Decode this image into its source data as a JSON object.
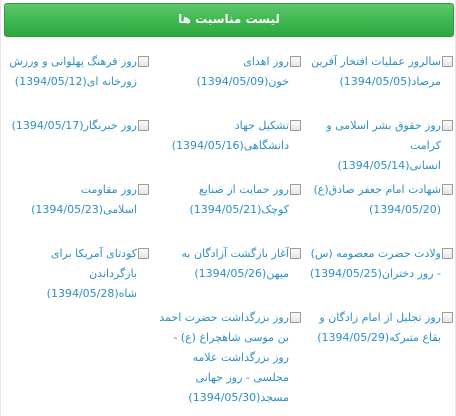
{
  "header": {
    "title": "لیست مناسبت ها"
  },
  "items": [
    {
      "label": "سالروز عملیات افتخار آفرین مرصاد(1394/05/05)"
    },
    {
      "label": "روز اهدای خون(1394/05/09)"
    },
    {
      "label": "روز فرهنگ پهلوانی و ورزش زورخانه ای(1394/05/12)"
    },
    {
      "label": "روز حقوق بشر اسلامی و کرامت انسانی(1394/05/14)"
    },
    {
      "label": "تشکیل جهاد دانشگاهی(1394/05/16)"
    },
    {
      "label": "روز خبرنگار(1394/05/17)"
    },
    {
      "label": "شهادت امام جعفر صادق(ع)(1394/05/20)"
    },
    {
      "label": "روز حمایت از صنایع کوچک(1394/05/21)"
    },
    {
      "label": "روز مقاومت اسلامی(1394/05/23)"
    },
    {
      "label": "ولادت حضرت معصومه (س) - روز دختران(1394/05/25)"
    },
    {
      "label": "آغاز بازگشت آزادگان به میهن(1394/05/26)"
    },
    {
      "label": "کودتای آمریکا برای بازگرداندن شاه(1394/05/28)"
    },
    {
      "label": "روز تجلیل از امام زادگان و بقاع متبرکه(1394/05/29)"
    },
    {
      "label": "روز بزرگداشت حضرت احمد بن موسی شاهچراغ (ع) - روز بزرگداشت علامه مجلسی - روز جهانی مسجد(1394/05/30)"
    }
  ],
  "colors": {
    "header_green": "#3db64f",
    "link_blue": "#2d8fc4"
  }
}
